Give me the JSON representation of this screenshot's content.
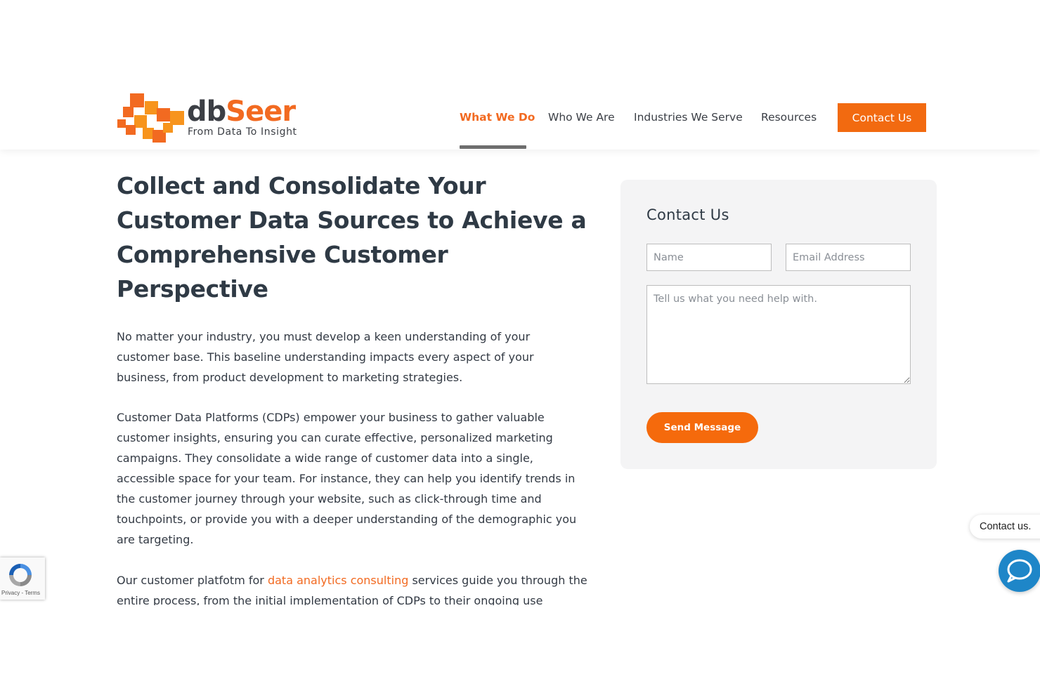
{
  "brand": {
    "word_dark": "db",
    "word_accent": "Seer",
    "tagline": "From Data To Insight",
    "accent_color": "#f26a21"
  },
  "nav": {
    "items": [
      {
        "label": "What We Do",
        "active": true
      },
      {
        "label": "Who We Are",
        "active": false
      },
      {
        "label": "Industries We Serve",
        "active": false
      },
      {
        "label": "Resources",
        "active": false
      }
    ],
    "cta_label": "Contact Us"
  },
  "main": {
    "title": "Collect and Consolidate Your Customer Data Sources to Achieve a Comprehensive Customer Perspective",
    "paragraph1": "No matter your industry, you must develop a keen understanding of your customer base. This baseline understanding impacts every aspect of your business, from product development to marketing strategies.",
    "paragraph2": "Customer Data Platforms (CDPs) empower your business to gather valuable customer insights, ensuring you can curate effective, personalized marketing campaigns. They consolidate a wide range of customer data into a single, accessible space for your team. For instance, they can help you identify trends in the customer journey through your website, such as click-through time and touchpoints, or provide you with a deeper understanding of the demographic you are targeting.",
    "paragraph3_before": "Our customer platfotm for ",
    "paragraph3_link": "data analytics consulting",
    "paragraph3_after": " services guide you through the entire process, from the initial implementation of CDPs to their ongoing use"
  },
  "contact_form": {
    "title": "Contact Us",
    "name_placeholder": "Name",
    "email_placeholder": "Email Address",
    "message_placeholder": "Tell us what you need help with.",
    "submit_label": "Send Message"
  },
  "chat_widget": {
    "label": "Contact us.",
    "icon": "chat-bubble-icon",
    "color": "#1e86c8"
  },
  "recaptcha": {
    "links": "Privacy - Terms",
    "icon": "recaptcha-icon"
  }
}
